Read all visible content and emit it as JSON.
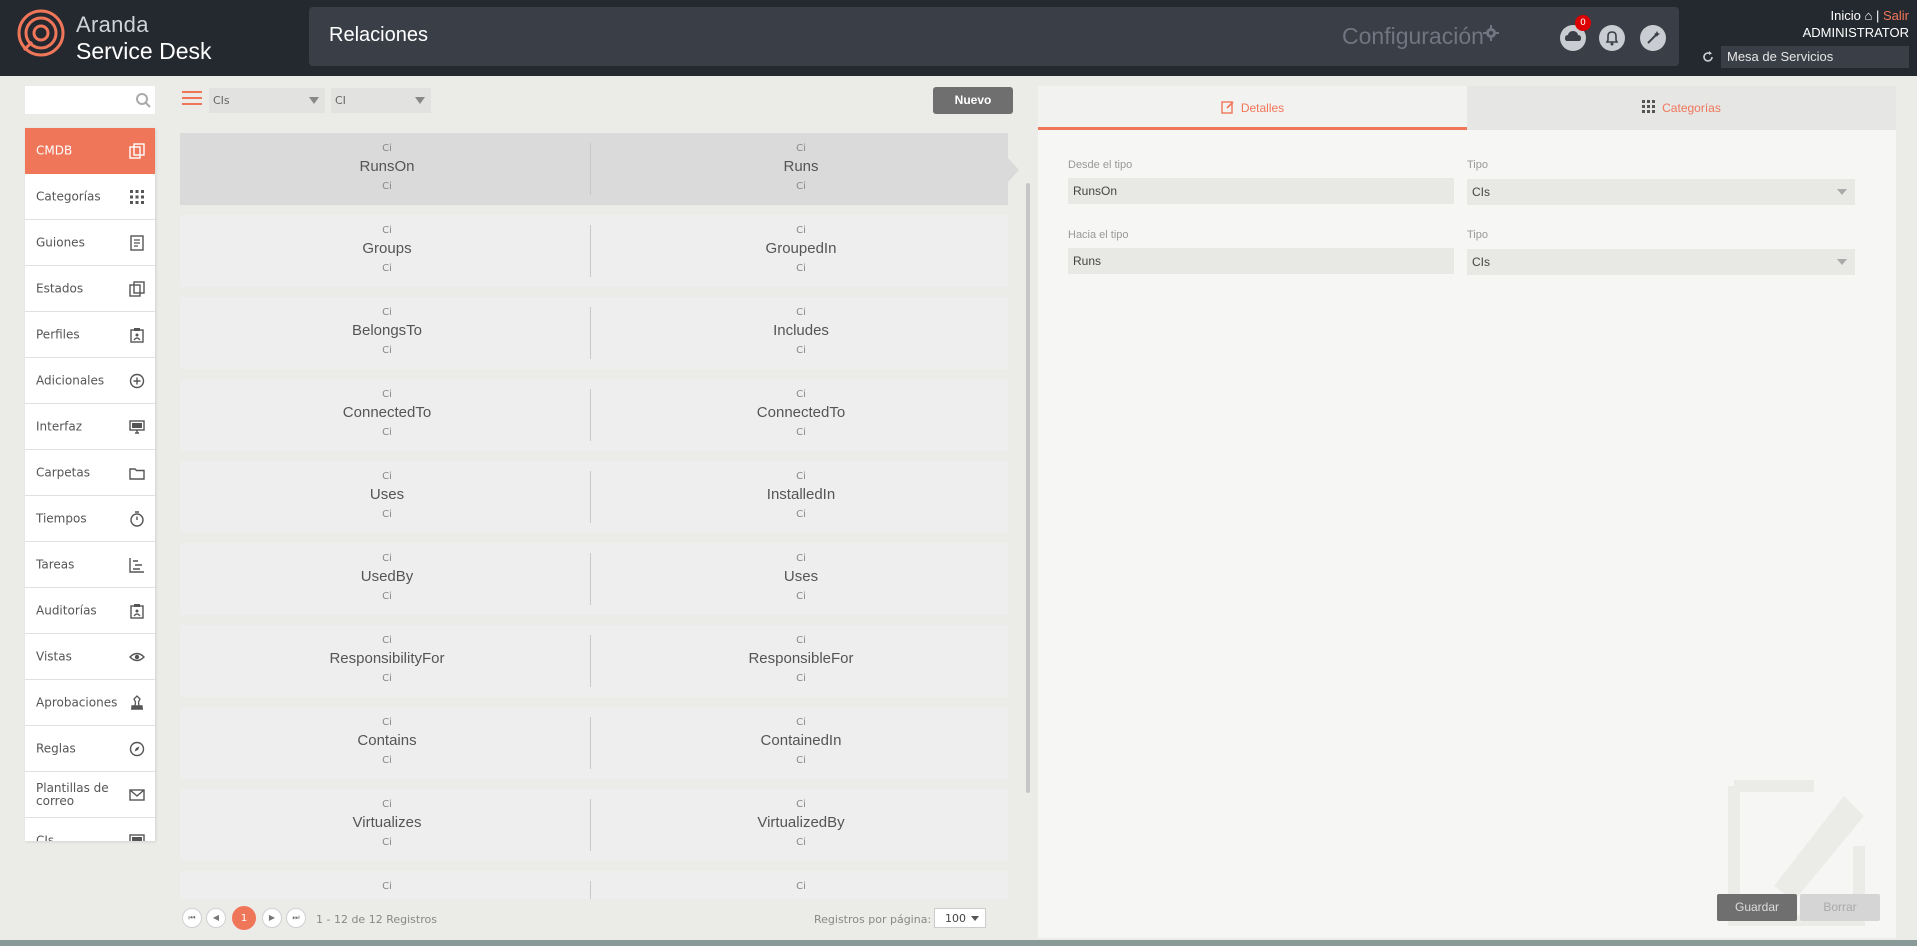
{
  "header": {
    "brand_line1": "Aranda",
    "brand_line2": "Service Desk",
    "page_title": "Relaciones",
    "config_label": "Configuración",
    "notification_count": "0",
    "inicio_label": "Inicio",
    "separator": "|",
    "salir_label": "Salir",
    "user_name": "ADMINISTRATOR",
    "service_selector": "Mesa de Servicios"
  },
  "sidebar": {
    "search_placeholder": "",
    "items": [
      {
        "label": "CMDB",
        "icon": "copy-icon",
        "active": true
      },
      {
        "label": "Categorías",
        "icon": "grid-icon"
      },
      {
        "label": "Guiones",
        "icon": "document-icon"
      },
      {
        "label": "Estados",
        "icon": "copy-icon"
      },
      {
        "label": "Perfiles",
        "icon": "clipboard-icon"
      },
      {
        "label": "Adicionales",
        "icon": "plus-circle-icon"
      },
      {
        "label": "Interfaz",
        "icon": "monitor-icon"
      },
      {
        "label": "Carpetas",
        "icon": "folder-icon"
      },
      {
        "label": "Tiempos",
        "icon": "stopwatch-icon"
      },
      {
        "label": "Tareas",
        "icon": "tasks-icon"
      },
      {
        "label": "Auditorías",
        "icon": "clipboard-icon"
      },
      {
        "label": "Vistas",
        "icon": "eye-icon"
      },
      {
        "label": "Aprobaciones",
        "icon": "stamp-icon"
      },
      {
        "label": "Reglas",
        "icon": "compass-icon"
      },
      {
        "label": "Plantillas de correo",
        "icon": "mail-icon"
      },
      {
        "label": "CIs",
        "icon": "monitor-icon"
      }
    ]
  },
  "toolbar": {
    "filter1": "CIs",
    "filter2": "CI",
    "new_button": "Nuevo"
  },
  "relations": [
    {
      "from_type_top": "Ci",
      "from": "RunsOn",
      "from_type_bottom": "Ci",
      "to_type_top": "Ci",
      "to": "Runs",
      "to_type_bottom": "Ci",
      "selected": true
    },
    {
      "from_type_top": "Ci",
      "from": "Groups",
      "from_type_bottom": "Ci",
      "to_type_top": "Ci",
      "to": "GroupedIn",
      "to_type_bottom": "Ci"
    },
    {
      "from_type_top": "Ci",
      "from": "BelongsTo",
      "from_type_bottom": "Ci",
      "to_type_top": "Ci",
      "to": "Includes",
      "to_type_bottom": "Ci"
    },
    {
      "from_type_top": "Ci",
      "from": "ConnectedTo",
      "from_type_bottom": "Ci",
      "to_type_top": "Ci",
      "to": "ConnectedTo",
      "to_type_bottom": "Ci"
    },
    {
      "from_type_top": "Ci",
      "from": "Uses",
      "from_type_bottom": "Ci",
      "to_type_top": "Ci",
      "to": "InstalledIn",
      "to_type_bottom": "Ci"
    },
    {
      "from_type_top": "Ci",
      "from": "UsedBy",
      "from_type_bottom": "Ci",
      "to_type_top": "Ci",
      "to": "Uses",
      "to_type_bottom": "Ci"
    },
    {
      "from_type_top": "Ci",
      "from": "ResponsibilityFor",
      "from_type_bottom": "Ci",
      "to_type_top": "Ci",
      "to": "ResponsibleFor",
      "to_type_bottom": "Ci"
    },
    {
      "from_type_top": "Ci",
      "from": "Contains",
      "from_type_bottom": "Ci",
      "to_type_top": "Ci",
      "to": "ContainedIn",
      "to_type_bottom": "Ci"
    },
    {
      "from_type_top": "Ci",
      "from": "Virtualizes",
      "from_type_bottom": "Ci",
      "to_type_top": "Ci",
      "to": "VirtualizedBy",
      "to_type_bottom": "Ci"
    },
    {
      "from_type_top": "Ci",
      "from": "",
      "from_type_bottom": "",
      "to_type_top": "Ci",
      "to": "",
      "to_type_bottom": ""
    }
  ],
  "pager": {
    "current_page": "1",
    "range_info": "1 - 12 de 12 Registros",
    "per_page_label": "Registros por página:",
    "per_page_value": "100"
  },
  "details": {
    "tab_details": "Detalles",
    "tab_categories": "Categorías",
    "from_label": "Desde el tipo",
    "from_value": "RunsOn",
    "from_type_label": "Tipo",
    "from_type_value": "CIs",
    "to_label": "Hacia el tipo",
    "to_value": "Runs",
    "to_type_label": "Tipo",
    "to_type_value": "CIs",
    "save_button": "Guardar",
    "delete_button": "Borrar"
  },
  "colors": {
    "accent": "#f0765a",
    "header_bg": "#24282f",
    "title_bg": "#3a3f47",
    "badge": "#dd0000"
  }
}
